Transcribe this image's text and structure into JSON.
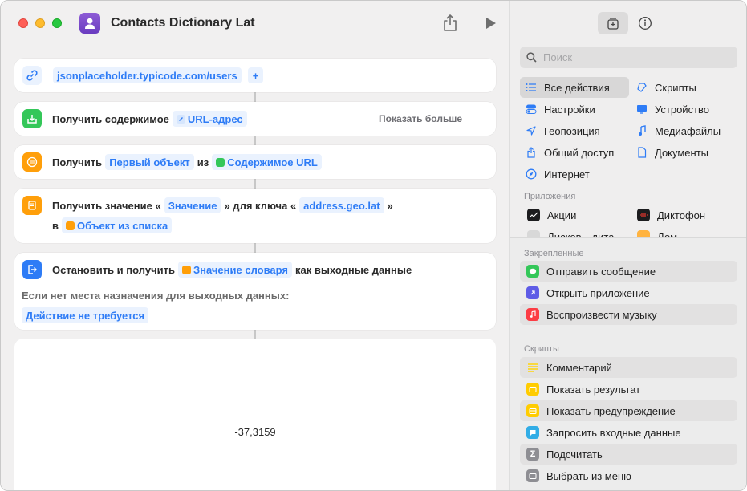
{
  "window": {
    "title": "Contacts Dictionary Lat"
  },
  "actions": {
    "url": {
      "value": "jsonplaceholder.typicode.com/users",
      "add": "+"
    },
    "get_contents": {
      "label": "Получить содержимое",
      "token": "URL-адрес",
      "show_more": "Показать больше"
    },
    "get_item": {
      "label": "Получить",
      "token_item": "Первый объект",
      "from": "из",
      "token_source": "Содержимое URL"
    },
    "get_value": {
      "label_start": "Получить значение «",
      "token_value": "Значение",
      "label_mid": "» для ключа «",
      "token_key": "address.geo.lat",
      "label_end": "»",
      "label_in": "в",
      "token_dict": "Объект из списка"
    },
    "stop_output": {
      "label": "Остановить и получить",
      "token": "Значение словаря",
      "label_end": "как выходные данные",
      "fallback_label": "Если нет места назначения для выходных данных:",
      "fallback_value": "Действие не требуется"
    }
  },
  "result": {
    "value": "-37,3159"
  },
  "library": {
    "search_placeholder": "Поиск",
    "categories": [
      {
        "label": "Все действия",
        "icon": "list-icon"
      },
      {
        "label": "Скрипты",
        "icon": "scripts-icon"
      },
      {
        "label": "Настройки",
        "icon": "toggle-icon"
      },
      {
        "label": "Устройство",
        "icon": "display-icon"
      },
      {
        "label": "Геопозиция",
        "icon": "location-icon"
      },
      {
        "label": "Медиафайлы",
        "icon": "music-note-icon"
      },
      {
        "label": "Общий доступ",
        "icon": "share-icon"
      },
      {
        "label": "Документы",
        "icon": "document-icon"
      },
      {
        "label": "Интернет",
        "icon": "compass-icon"
      }
    ],
    "apps_header": "Приложения",
    "apps": [
      {
        "label": "Акции",
        "icon": "stocks-icon"
      },
      {
        "label": "Диктофон",
        "icon": "voice-memos-icon"
      },
      {
        "label": "Дисков…дита",
        "icon": "disk-utility-icon"
      },
      {
        "label": "Дом",
        "icon": "home-icon"
      }
    ],
    "pinned_header": "Закрепленные",
    "pinned": [
      {
        "label": "Отправить сообщение",
        "color": "#34c759"
      },
      {
        "label": "Открыть приложение",
        "color": "#5e5ce6"
      },
      {
        "label": "Воспроизвести музыку",
        "color": "#fc3c44"
      }
    ],
    "scripts_header": "Скрипты",
    "scripts": [
      {
        "label": "Комментарий",
        "color": "#ffd60a"
      },
      {
        "label": "Показать результат",
        "color": "#ffcc00"
      },
      {
        "label": "Показать предупреждение",
        "color": "#ffcc00"
      },
      {
        "label": "Запросить входные данные",
        "color": "#32ade6"
      },
      {
        "label": "Подсчитать",
        "color": "#8e8e93"
      },
      {
        "label": "Выбрать из меню",
        "color": "#8e8e93"
      }
    ]
  },
  "colors": {
    "accent": "#2e7cf6",
    "url_icon": "#2e7cf6",
    "get_contents_icon": "#34c759",
    "orange_icon": "#ff9f0a",
    "stop_icon": "#2e7cf6"
  }
}
